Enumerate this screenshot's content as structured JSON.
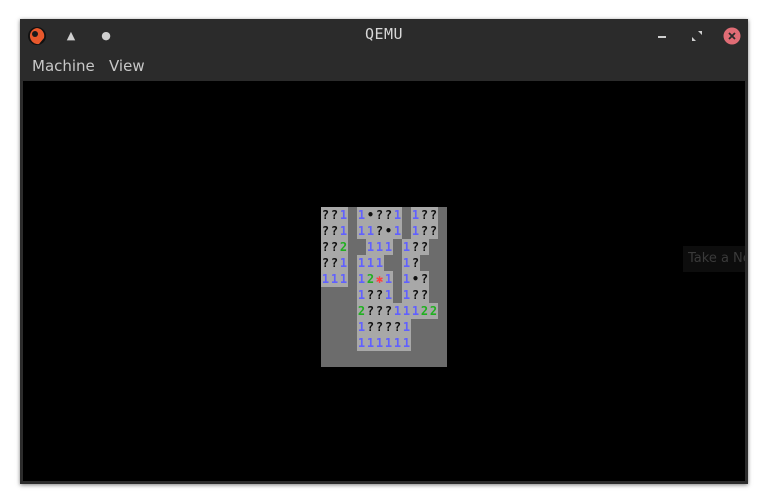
{
  "window": {
    "title": "QEMU",
    "app_icon": "qemu-logo-icon",
    "titlebar_buttons": [
      {
        "name": "shade-up-icon",
        "glyph": "▲"
      },
      {
        "name": "sticky-dot-icon",
        "glyph": "●"
      }
    ],
    "controls": [
      "minimize-icon",
      "maximize-icon",
      "close-icon"
    ],
    "close_color": "#e06c75"
  },
  "menu": [
    {
      "label": "Machine"
    },
    {
      "label": "View"
    }
  ],
  "toast": {
    "text": "Take a Ne"
  },
  "board": {
    "cols": 14,
    "rows": 10,
    "grid": [
      "??1 1*??1 1?? ",
      "??1 11?*1 1?? ",
      "??2  111 1?? ",
      "??1 111  1?  ",
      "111 12*1 1*? ",
      "    1??1 1?? ",
      "    2???11122",
      "    1????1   ",
      "    111111   ",
      "             "
    ]
  },
  "colors": {
    "board_bg": "#6c6c6c",
    "revealed": "#a8a8a8",
    "one": "#6060ff",
    "two": "#20b020",
    "mine": "#ff4040"
  }
}
